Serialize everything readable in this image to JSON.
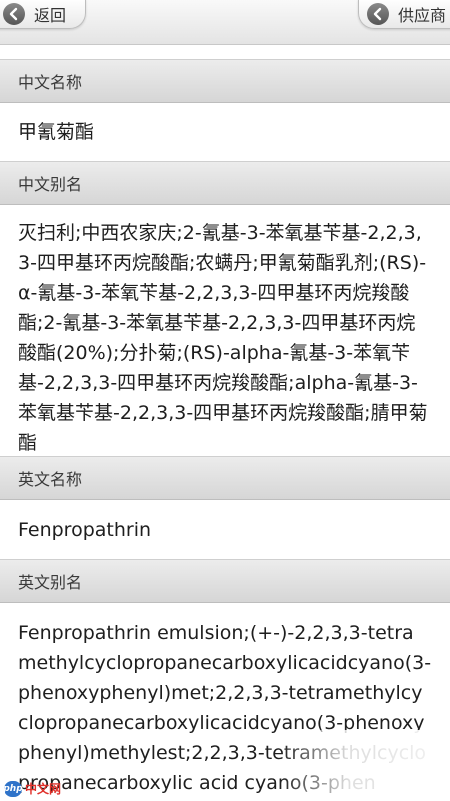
{
  "topbar": {
    "back_label": "返回",
    "supplier_label": "供应商"
  },
  "sections": [
    {
      "header": "中文名称",
      "value": "甲氰菊酯"
    },
    {
      "header": "中文别名",
      "value": "灭扫利;中西农家庆;2-氰基-3-苯氧基苄基-2,2,3,3-四甲基环丙烷酸酯;农螨丹;甲氰菊酯乳剂;(RS)-α-氰基-3-苯氧苄基-2,2,3,3-四甲基环丙烷羧酸酯;2-氰基-3-苯氧基苄基-2,2,3,3-四甲基环丙烷酸酯(20%);分扑菊;(RS)-alpha-氰基-3-苯氧苄基-2,2,3,3-四甲基环丙烷羧酸酯;alpha-氰基-3-苯氧基苄基-2,2,3,3-四甲基环丙烷羧酸酯;腈甲菊酯"
    },
    {
      "header": "英文名称",
      "value": "Fenpropathrin"
    },
    {
      "header": "英文别名",
      "value": "Fenpropathrin emulsion;(+-)-2,2,3,3-tetramethylcyclopropanecarboxylicacidcyano(3-phenoxyphenyl)met;2,2,3,3-tetramethylcyclopropanecarboxylicacidcyano(3-phenoxyphenyl)methylest;2,2,3,3-tetramethylcyclopropanecarboxylic acid cyano(3-phen"
    }
  ],
  "watermark": {
    "logo": "php",
    "text": "中文网"
  }
}
